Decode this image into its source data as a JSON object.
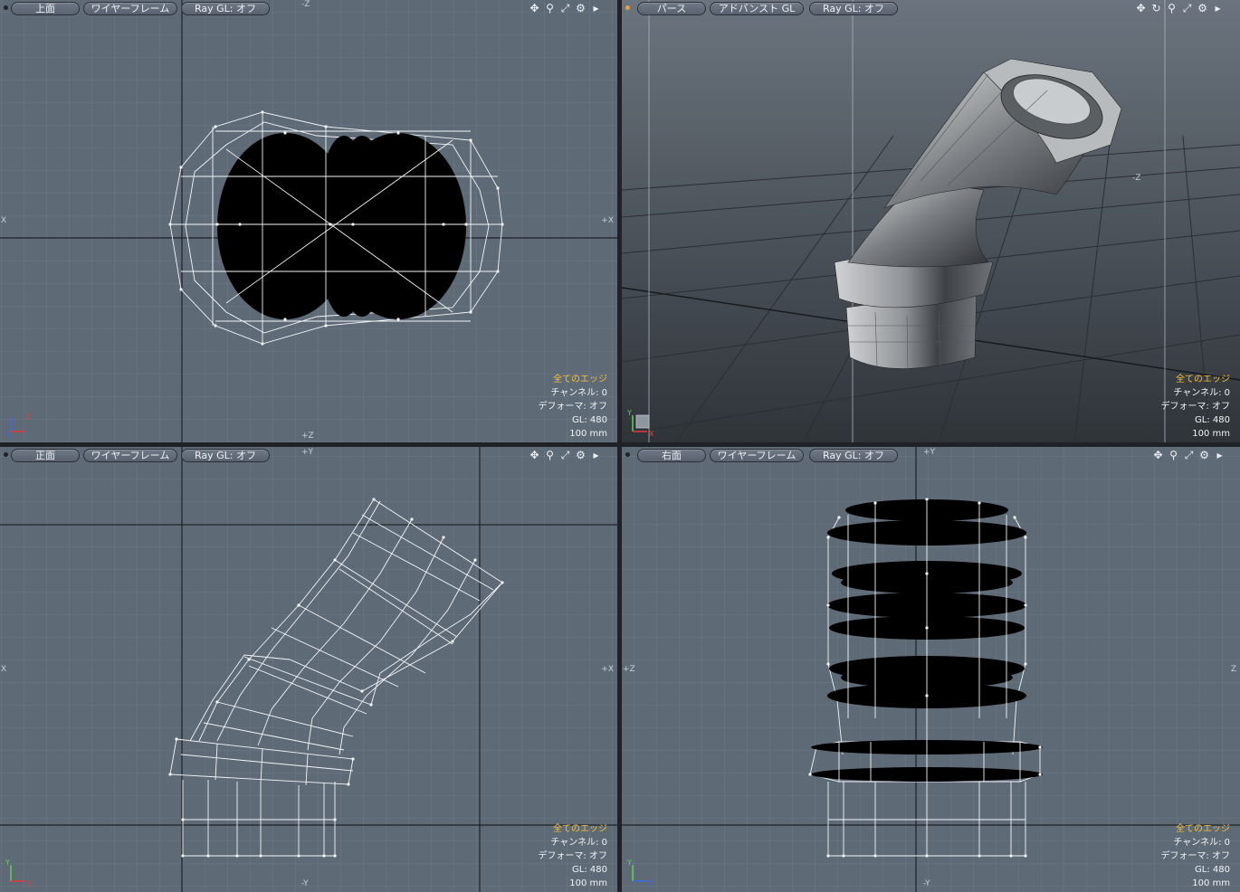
{
  "viewports": [
    {
      "id": "top",
      "view_label": "上面",
      "shading_label": "ワイヤーフレーム",
      "raygl_label": "Ray GL: オフ",
      "axis_labels": {
        "top": "-Z",
        "bottom": "+Z",
        "left": "X",
        "right": "+X"
      },
      "info": {
        "edges": "全てのエッジ",
        "channel": "チャンネル: 0",
        "deformer": "デフォーマ: オフ",
        "gl": "GL: 480",
        "scale": "100 mm"
      },
      "tools": [
        "move-icon",
        "zoom-icon",
        "fit-icon",
        "gear-icon",
        "menu-arrow-icon"
      ]
    },
    {
      "id": "perspective",
      "view_label": "パース",
      "shading_label": "アドバンスト GL",
      "raygl_label": "Ray GL: オフ",
      "axis_labels": {
        "top": "",
        "bottom": "",
        "left": "",
        "right": "-Z"
      },
      "info": {
        "edges": "全てのエッジ",
        "channel": "チャンネル: 0",
        "deformer": "デフォーマ: オフ",
        "gl": "GL: 480",
        "scale": "100 mm"
      },
      "tools": [
        "move-icon",
        "rotate-icon",
        "zoom-icon",
        "fit-icon",
        "gear-icon",
        "menu-arrow-icon"
      ]
    },
    {
      "id": "front",
      "view_label": "正面",
      "shading_label": "ワイヤーフレーム",
      "raygl_label": "Ray GL: オフ",
      "axis_labels": {
        "top": "+Y",
        "bottom": "-Y",
        "left": "X",
        "right": "+X"
      },
      "info": {
        "edges": "全てのエッジ",
        "channel": "チャンネル: 0",
        "deformer": "デフォーマ: オフ",
        "gl": "GL: 480",
        "scale": "100 mm"
      },
      "tools": [
        "move-icon",
        "zoom-icon",
        "fit-icon",
        "gear-icon",
        "menu-arrow-icon"
      ]
    },
    {
      "id": "right",
      "view_label": "右面",
      "shading_label": "ワイヤーフレーム",
      "raygl_label": "Ray GL: オフ",
      "axis_labels": {
        "top": "+Y",
        "bottom": "-Y",
        "left": "+Z",
        "right": "Z"
      },
      "info": {
        "edges": "全てのエッジ",
        "channel": "チャンネル: 0",
        "deformer": "デフォーマ: オフ",
        "gl": "GL: 480",
        "scale": "100 mm"
      },
      "tools": [
        "move-icon",
        "zoom-icon",
        "fit-icon",
        "gear-icon",
        "menu-arrow-icon"
      ]
    }
  ],
  "colors": {
    "viewport_bg": "#5f6a77",
    "grid": "#6d7784",
    "grid_major": "#202428",
    "wire": "#f4f6f8",
    "edge_label": "#f6c23a"
  }
}
